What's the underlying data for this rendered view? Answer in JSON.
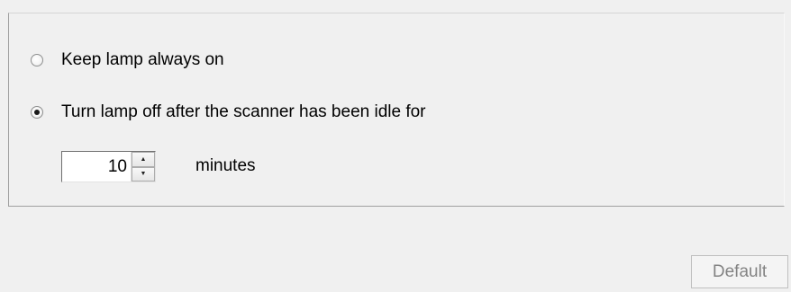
{
  "lamp_options": {
    "keep_on": {
      "label": "Keep lamp always on",
      "selected": false
    },
    "turn_off": {
      "label": "Turn lamp off after the scanner has been idle for",
      "selected": true
    }
  },
  "idle_timeout": {
    "value": "10",
    "unit_label": "minutes"
  },
  "buttons": {
    "default_label": "Default",
    "default_enabled": false
  }
}
